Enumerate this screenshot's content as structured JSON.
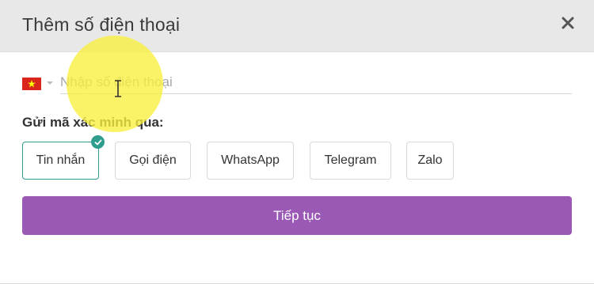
{
  "dialog": {
    "title": "Thêm số điện thoại",
    "close_icon": "close-icon"
  },
  "phone": {
    "country_flag": "vietnam-flag-icon",
    "placeholder": "Nhập số điện thoại",
    "value": ""
  },
  "verification": {
    "label": "Gửi mã xác minh qua:",
    "options": [
      {
        "label": "Tin nhắn",
        "selected": true
      },
      {
        "label": "Gọi điện",
        "selected": false
      },
      {
        "label": "WhatsApp",
        "selected": false
      },
      {
        "label": "Telegram",
        "selected": false
      },
      {
        "label": "Zalo",
        "selected": false
      }
    ]
  },
  "continue_label": "Tiếp tục",
  "colors": {
    "header_bg": "#e8e8e9",
    "accent_teal": "#2e9d8e",
    "button_purple": "#9b59b6",
    "highlight_yellow": "#faf03c"
  }
}
